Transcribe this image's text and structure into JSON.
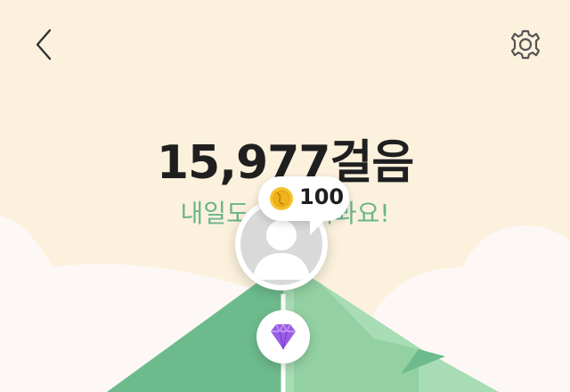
{
  "header": {
    "back_icon": "chevron-left-icon",
    "settings_icon": "gear-icon"
  },
  "steps": {
    "title": "15,977걸음"
  },
  "subtitle": "내일도 또 걸어봐요!",
  "reward": {
    "coin_icon": "coin-icon",
    "amount": "100"
  },
  "profile": {
    "avatar_icon": "avatar-placeholder-icon"
  },
  "milestone": {
    "gem_icon": "diamond-icon"
  },
  "colors": {
    "background": "#fbf1dd",
    "mountain_dark": "#6dbb8c",
    "mountain_light": "#a8dcb4",
    "cloud": "#fdf8f5",
    "subtitle": "#69b58a",
    "gem": "#9b5de5"
  }
}
